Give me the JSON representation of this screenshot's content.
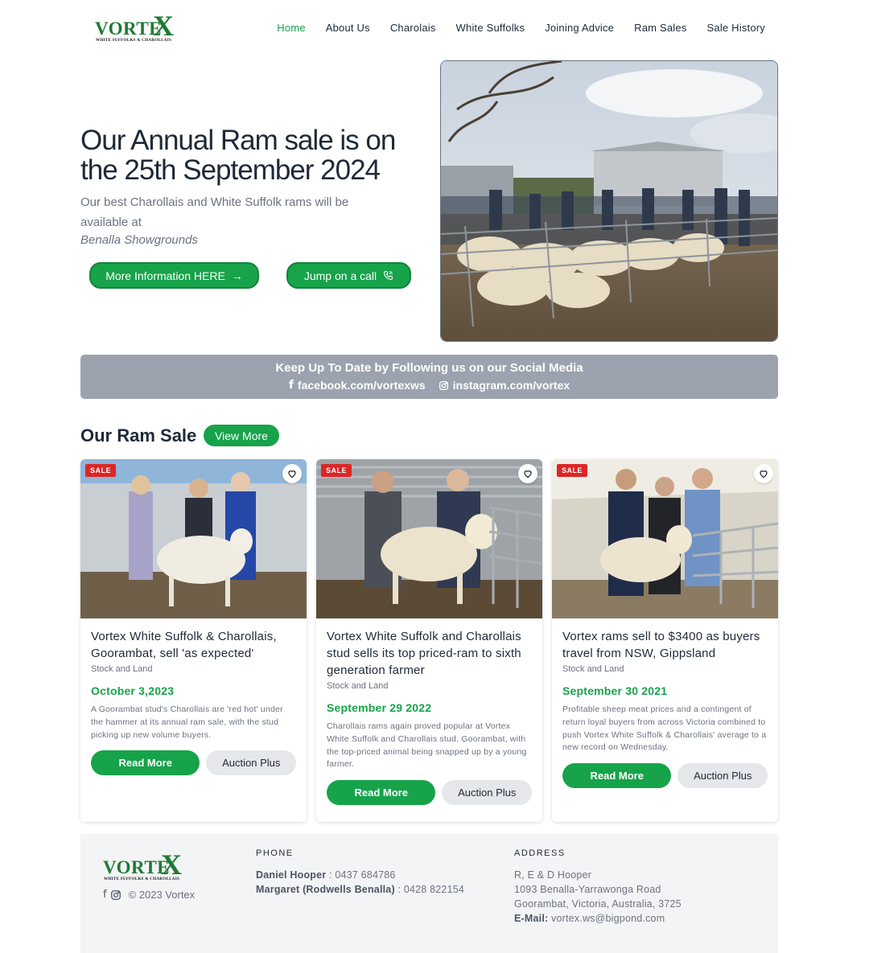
{
  "brand": {
    "logo_word": "VORTE",
    "logo_x": "X",
    "logo_tagline": "WHITE SUFFOLKS & CHAROLLAIS"
  },
  "nav": {
    "items": [
      {
        "label": "Home",
        "active": true
      },
      {
        "label": "About Us"
      },
      {
        "label": "Charolais"
      },
      {
        "label": "White Suffolks"
      },
      {
        "label": "Joining Advice"
      },
      {
        "label": "Ram Sales"
      },
      {
        "label": "Sale History"
      }
    ]
  },
  "hero": {
    "title": "Our Annual Ram sale is on the 25th September 2024",
    "subtitle": "Our best Charollais and White Suffolk rams will be available at",
    "venue": "Benalla Showgrounds",
    "info_button": "More Information HERE",
    "call_button": "Jump on a call"
  },
  "social": {
    "title": "Keep Up To Date by Following us on our Social Media",
    "facebook": "facebook.com/vortexws",
    "instagram": "instagram.com/vortex"
  },
  "ram_sale": {
    "title": "Our Ram Sale",
    "view_more": "View More",
    "cards": [
      {
        "badge": "SALE",
        "title": "Vortex White Suffolk & Charollais, Goorambat, sell 'as expected'",
        "source": "Stock and Land",
        "date": "October 3,2023",
        "desc": "A Goorambat stud's Charollais are 'red hot' under the hammer at its annual ram sale, with the stud picking up new volume buyers.",
        "read_more": "Read More",
        "auction": "Auction Plus"
      },
      {
        "badge": "SALE",
        "title": "Vortex White Suffolk and Charollais stud sells its top priced-ram to sixth generation farmer",
        "source": "Stock and Land",
        "date": "September 29 2022",
        "desc": "Charollais rams again proved popular at Vortex White Suffolk and Charollais stud, Goorambat, with the top-priced animal being snapped up by a young farmer.",
        "read_more": "Read More",
        "auction": "Auction Plus"
      },
      {
        "badge": "SALE",
        "title": "Vortex rams sell to $3400 as buyers travel from NSW, Gippsland",
        "source": "Stock and Land",
        "date": "September 30 2021",
        "desc": "Profitable sheep meat prices and a contingent of return loyal buyers from across Victoria combined to push Vortex White Suffolk & Charollais' average to a new record on Wednesday.",
        "read_more": "Read More",
        "auction": "Auction Plus"
      }
    ]
  },
  "footer": {
    "copyright": "© 2023 Vortex",
    "phone_heading": "PHONE",
    "phone1_name": "Daniel Hooper",
    "phone1_number": " : 0437 684786",
    "phone2_name": "Margaret (Rodwells Benalla)",
    "phone2_number": " : 0428 822154",
    "address_heading": "ADDRESS",
    "address1": "R, E & D Hooper",
    "address2": "1093 Benalla-Yarrawonga Road",
    "address3": "Goorambat, Victoria, Australia, 3725",
    "email_label": "E-Mail:",
    "email": " vortex.ws@bigpond.com"
  },
  "colors": {
    "accent": "#16a34a",
    "sale_badge": "#dc2626",
    "social_bg": "#9ca3af",
    "footer_bg": "#f3f4f6"
  }
}
